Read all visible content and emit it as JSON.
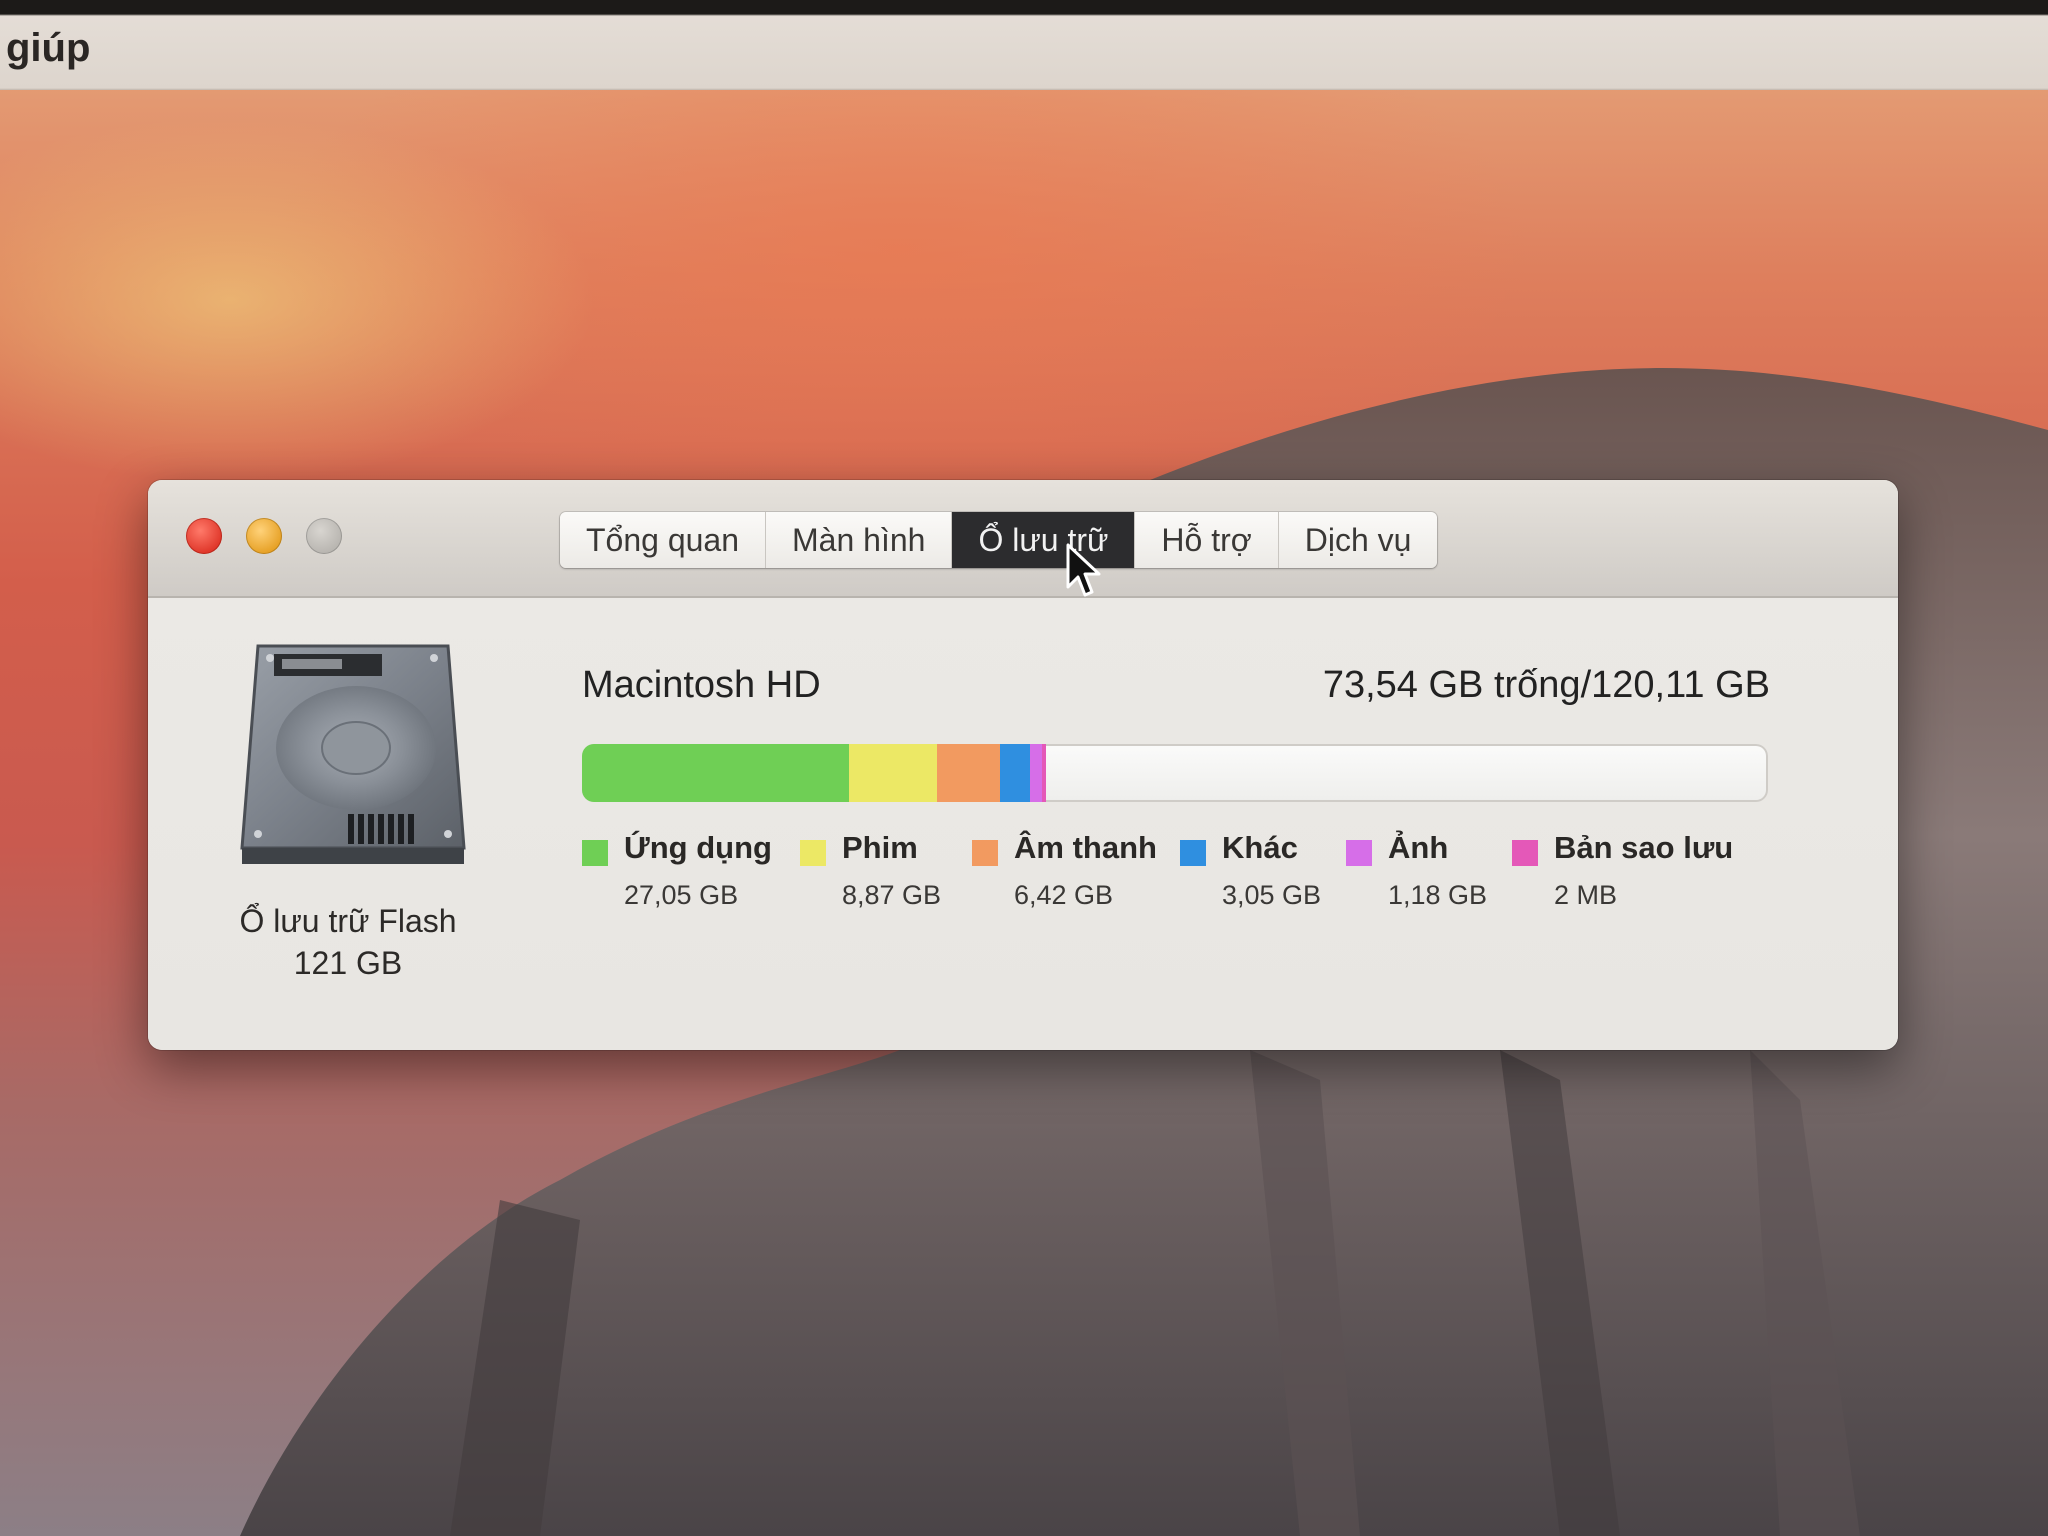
{
  "menubar": {
    "item": "giúp"
  },
  "window": {
    "tabs": [
      {
        "label": "Tổng quan",
        "active": false
      },
      {
        "label": "Màn hình",
        "active": false
      },
      {
        "label": "Ổ lưu trữ",
        "active": true
      },
      {
        "label": "Hỗ trợ",
        "active": false
      },
      {
        "label": "Dịch vụ",
        "active": false
      }
    ],
    "disk": {
      "icon": "hard-drive-icon",
      "caption_line1": "Ổ lưu trữ Flash",
      "caption_line2": "121 GB",
      "name": "Macintosh HD",
      "space": "73,54 GB trống/120,11 GB"
    },
    "categories": [
      {
        "label": "Ứng dụng",
        "size": "27,05 GB",
        "color": "#6fcf55",
        "gb": 27.05
      },
      {
        "label": "Phim",
        "size": "8,87 GB",
        "color": "#ece865",
        "gb": 8.87
      },
      {
        "label": "Âm thanh",
        "size": "6,42 GB",
        "color": "#f29a60",
        "gb": 6.42
      },
      {
        "label": "Khác",
        "size": "3,05 GB",
        "color": "#2f8fe0",
        "gb": 3.05
      },
      {
        "label": "Ảnh",
        "size": "1,18 GB",
        "color": "#d66ee8",
        "gb": 1.18
      },
      {
        "label": "Bản sao lưu",
        "size": "2 MB",
        "color": "#e458b8",
        "gb": 0.002
      }
    ],
    "total_gb": 120.11
  }
}
